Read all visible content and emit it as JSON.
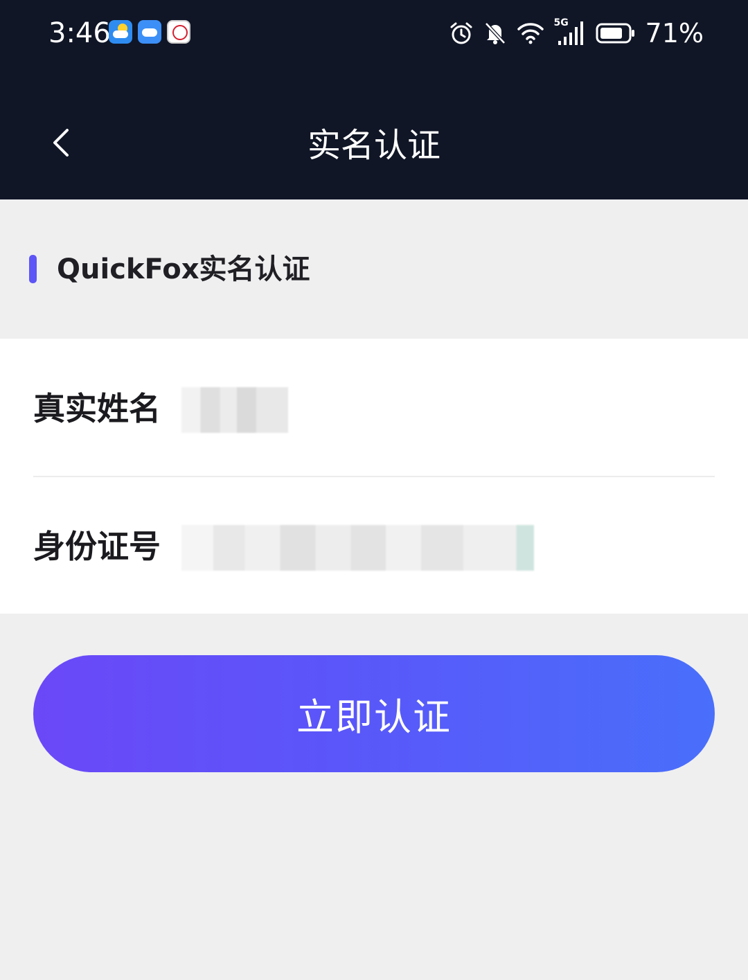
{
  "status_bar": {
    "time": "3:46",
    "app_icons": [
      "weather-icon",
      "cloud-icon",
      "bank-icon"
    ],
    "network": "5G",
    "battery": "71%"
  },
  "nav": {
    "title": "实名认证",
    "back_icon": "chevron-left-icon"
  },
  "section": {
    "title": "QuickFox实名认证",
    "accent_color": "#5d55f5"
  },
  "form": {
    "name_label": "真实姓名",
    "name_value": "",
    "id_label": "身份证号",
    "id_value": ""
  },
  "submit": {
    "label": "立即认证",
    "gradient_start": "#6b48f8",
    "gradient_end": "#496ffb"
  }
}
